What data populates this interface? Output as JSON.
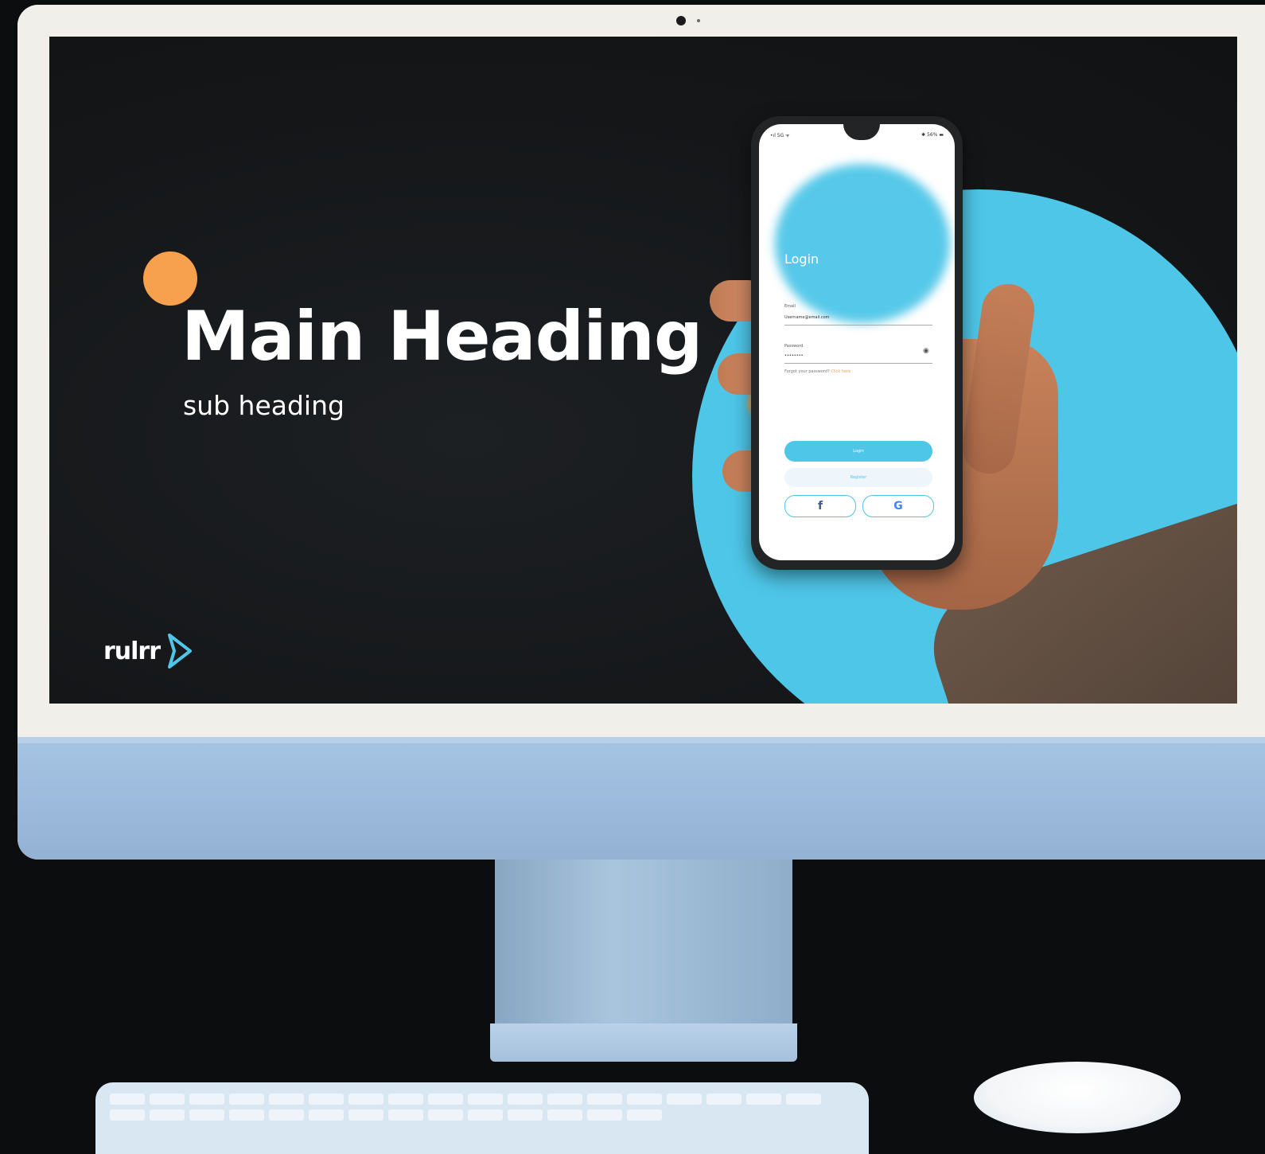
{
  "screen": {
    "main_heading": "Main Heading",
    "sub_heading": "sub heading",
    "logo_text": "rulrr"
  },
  "phone": {
    "status_left": "•ıl 5G ᯤ",
    "status_right": "✱ 56% ▬",
    "login_title": "Login",
    "email_label": "Email",
    "email_value": "Username@email.com",
    "password_label": "Password",
    "password_value": "••••••••",
    "forgot_text": "Forgot your password?",
    "forgot_link": "Click here",
    "login_button": "Login",
    "register_button": "Register",
    "facebook_glyph": "f",
    "google_glyph": "G"
  },
  "colors": {
    "accent_blue": "#4ec6e8",
    "accent_orange": "#f7a04d",
    "screen_bg": "#141618",
    "imac_chin": "#a5c3e2"
  }
}
